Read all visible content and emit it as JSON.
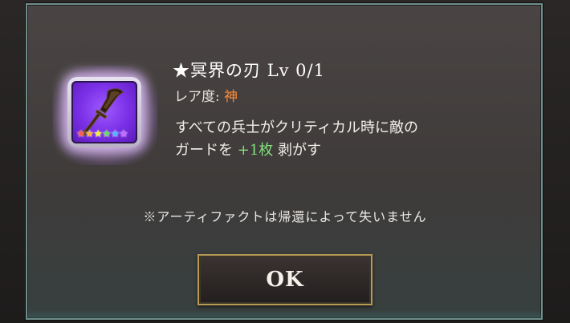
{
  "artifact": {
    "title_star": "★",
    "name": "冥界の刃",
    "level": "Lv 0/1",
    "rarity_label": "レア度:",
    "rarity_value": "神",
    "desc_line1": "すべての兵士がクリティカル時に敵の",
    "desc_line2_before": "ガードを",
    "desc_highlight": "+1枚",
    "desc_line2_after": "剥がす",
    "star_count": 6,
    "icon": "dagger-icon"
  },
  "notice": "※アーティファクトは帰還によって失いません",
  "ok_label": "OK",
  "colors": {
    "rarity_value": "#ff8a3a",
    "highlight": "#7fe07a",
    "icon_bg": "#7a2fe6",
    "panel_border": "#6f8d8a",
    "button_border": "#b89a55"
  }
}
